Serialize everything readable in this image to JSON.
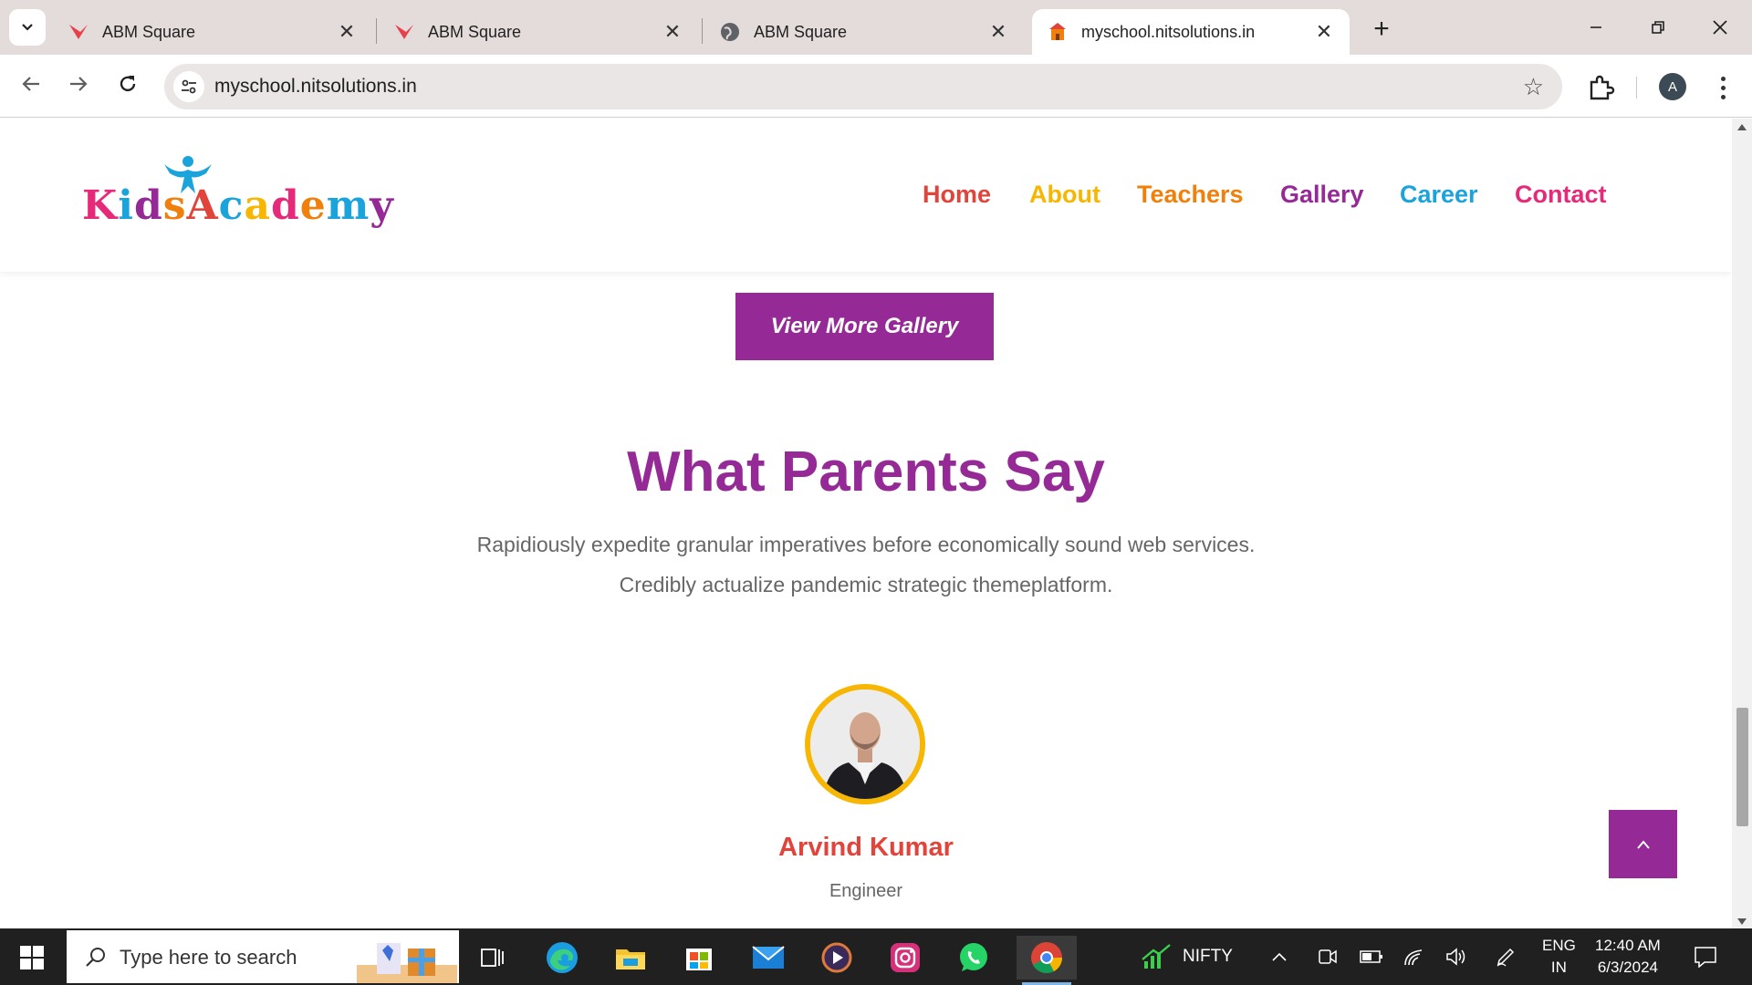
{
  "browser": {
    "tabs": [
      {
        "label": "ABM Square",
        "favicon": "abm-logo-icon"
      },
      {
        "label": "ABM Square",
        "favicon": "abm-logo-icon"
      },
      {
        "label": "ABM Square",
        "favicon": "globe-icon"
      },
      {
        "label": "myschool.nitsolutions.in",
        "favicon": "school-icon",
        "active": true
      }
    ],
    "url": "myschool.nitsolutions.in",
    "profile_initial": "A"
  },
  "site": {
    "logo_text": "KidsAcademy",
    "logo_letters": [
      "K",
      "i",
      "d",
      "s",
      "A",
      "c",
      "a",
      "d",
      "e",
      "m",
      "y"
    ],
    "nav": [
      "Home",
      "About",
      "Teachers",
      "Gallery",
      "Career",
      "Contact"
    ],
    "gallery_button": "View More Gallery",
    "section": {
      "title": "What Parents Say",
      "subtitle_line1": "Rapidiously expedite granular imperatives before economically sound web services.",
      "subtitle_line2": "Credibly actualize pandemic strategic themeplatform."
    },
    "testimonial": {
      "name": "Arvind Kumar",
      "role": "Engineer"
    }
  },
  "taskbar": {
    "search_placeholder": "Type here to search",
    "stock_label": "NIFTY",
    "lang_line1": "ENG",
    "lang_line2": "IN",
    "time": "12:40 AM",
    "date": "6/3/2024"
  },
  "colors": {
    "brand_purple": "#952a96",
    "nav_home": "#e0443a",
    "nav_about": "#f7b602",
    "nav_teachers": "#f07f0b",
    "nav_gallery": "#952a96",
    "nav_career": "#1ba3db",
    "nav_contact": "#e62a7a",
    "photo_ring": "#f7b602"
  }
}
